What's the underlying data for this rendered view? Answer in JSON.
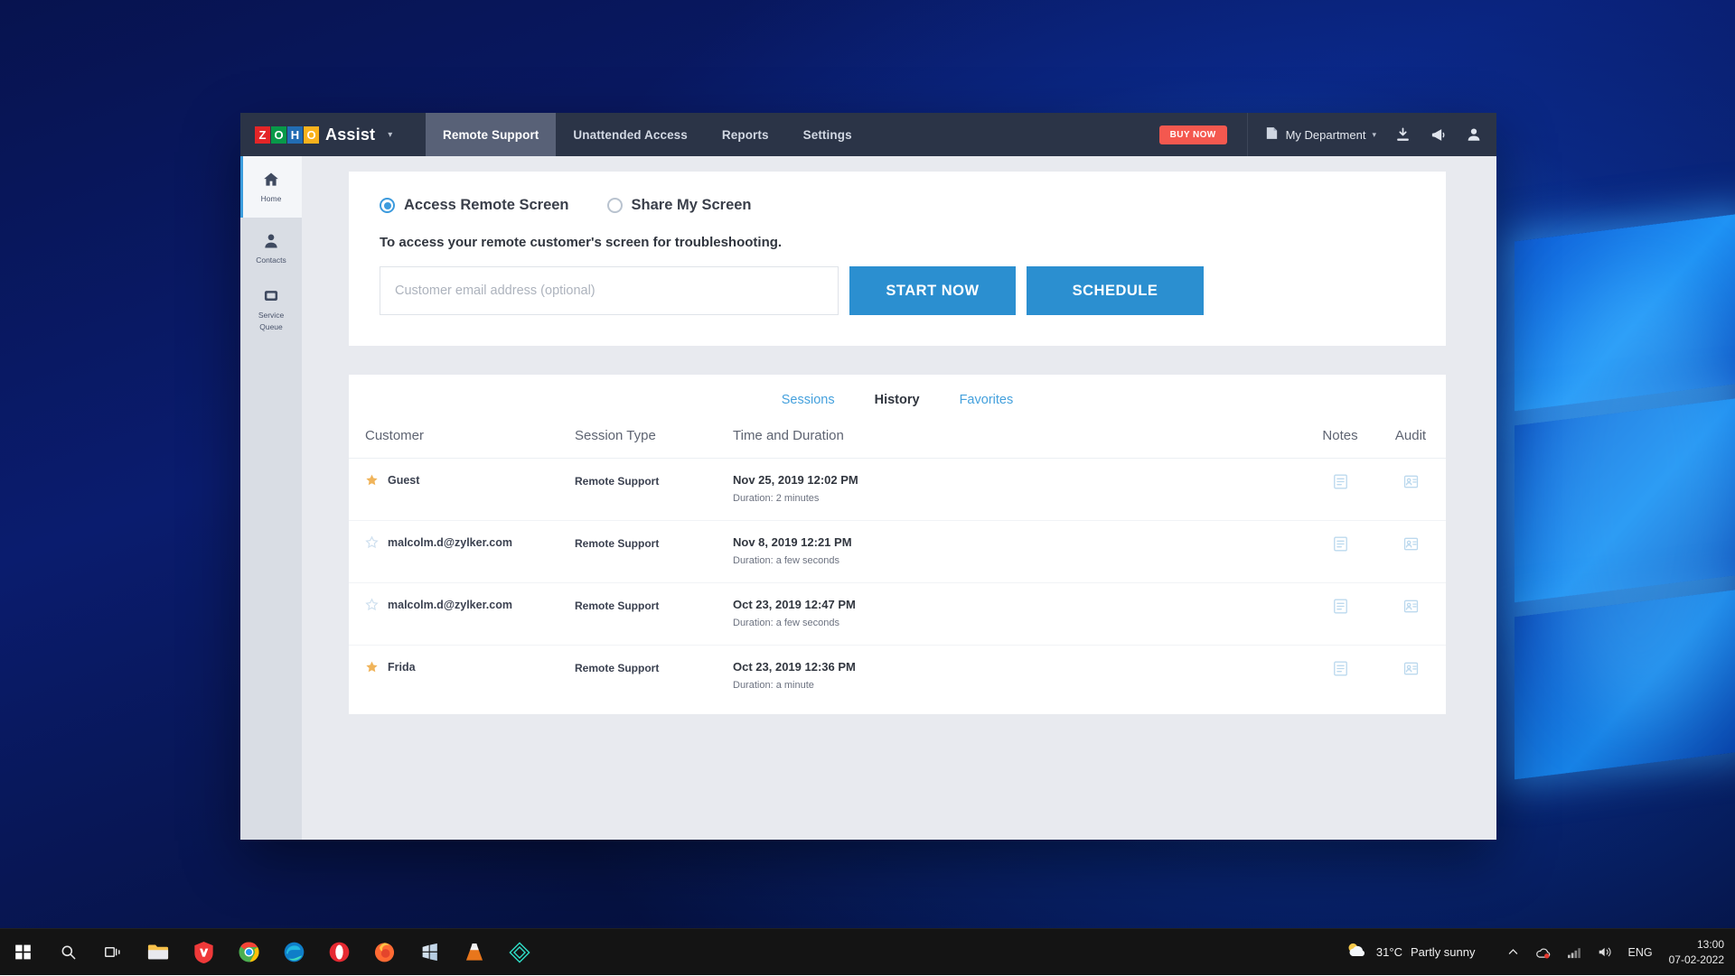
{
  "window": {
    "logo": {
      "letters": [
        {
          "char": "Z",
          "color": "#e42527"
        },
        {
          "char": "O",
          "color": "#089949"
        },
        {
          "char": "H",
          "color": "#226db4"
        },
        {
          "char": "O",
          "color": "#f9b21d"
        }
      ],
      "app_name": "Assist",
      "caret": "▾"
    },
    "nav_tabs": [
      {
        "label": "Remote Support",
        "active": true
      },
      {
        "label": "Unattended Access",
        "active": false
      },
      {
        "label": "Reports",
        "active": false
      },
      {
        "label": "Settings",
        "active": false
      }
    ],
    "buy_now_label": "BUY NOW",
    "buy_now_color": "#f4584f",
    "department": {
      "label": "My Department",
      "caret": "▾"
    },
    "top_icons": [
      "download-icon",
      "megaphone-icon",
      "user-icon"
    ]
  },
  "sidebar": {
    "items": [
      {
        "label": "Home",
        "icon": "home-icon",
        "active": true
      },
      {
        "label": "Contacts",
        "icon": "contacts-icon",
        "active": false
      },
      {
        "label": "Service\nQueue",
        "label_line1": "Service",
        "label_line2": "Queue",
        "icon": "service-queue-icon",
        "active": false
      }
    ]
  },
  "remote_panel": {
    "options": [
      {
        "label": "Access Remote Screen",
        "selected": true
      },
      {
        "label": "Share My Screen",
        "selected": false
      }
    ],
    "subtitle": "To access your remote customer's screen for troubleshooting.",
    "email_placeholder": "Customer email address (optional)",
    "email_value": "",
    "start_button": "START NOW",
    "schedule_button": "SCHEDULE",
    "accent_color": "#2b8fd0"
  },
  "history_panel": {
    "tabs": [
      {
        "label": "Sessions",
        "active": false
      },
      {
        "label": "History",
        "active": true
      },
      {
        "label": "Favorites",
        "active": false
      }
    ],
    "columns": [
      "Customer",
      "Session Type",
      "Time and Duration",
      "",
      "Notes",
      "Audit"
    ],
    "rows": [
      {
        "customer": "Guest",
        "star": "star-filled-icon",
        "star_color": "#f0b45a",
        "session_type": "Remote Support",
        "time": "Nov 25, 2019 12:02 PM",
        "duration": "Duration: 2 minutes",
        "notes_icon": "notes-icon",
        "audit_icon": "audit-icon"
      },
      {
        "customer": "malcolm.d@zylker.com",
        "star": "star-outline-icon",
        "star_color": "#cfe0ef",
        "session_type": "Remote Support",
        "time": "Nov 8, 2019 12:21 PM",
        "duration": "Duration: a few seconds",
        "notes_icon": "notes-icon",
        "audit_icon": "audit-icon"
      },
      {
        "customer": "malcolm.d@zylker.com",
        "star": "star-outline-icon",
        "star_color": "#cfe0ef",
        "session_type": "Remote Support",
        "time": "Oct 23, 2019 12:47 PM",
        "duration": "Duration: a few seconds",
        "notes_icon": "notes-icon",
        "audit_icon": "audit-icon"
      },
      {
        "customer": "Frida",
        "star": "star-filled-icon",
        "star_color": "#f0b45a",
        "session_type": "Remote Support",
        "time": "Oct 23, 2019 12:36 PM",
        "duration": "Duration: a minute",
        "notes_icon": "notes-icon",
        "audit_icon": "audit-icon"
      }
    ]
  },
  "taskbar": {
    "apps": [
      {
        "name": "start-button",
        "icon": "windows-logo-icon"
      },
      {
        "name": "search-button",
        "icon": "search-icon"
      },
      {
        "name": "task-view-button",
        "icon": "task-view-icon"
      },
      {
        "name": "file-explorer",
        "icon": "folder-icon"
      },
      {
        "name": "vivaldi-browser",
        "icon": "vivaldi-icon"
      },
      {
        "name": "chrome-browser",
        "icon": "chrome-icon"
      },
      {
        "name": "edge-browser",
        "icon": "edge-icon"
      },
      {
        "name": "opera-browser",
        "icon": "opera-icon"
      },
      {
        "name": "firefox-browser",
        "icon": "firefox-icon"
      },
      {
        "name": "microsoft-store",
        "icon": "store-icon"
      },
      {
        "name": "vlc-player",
        "icon": "vlc-cone-icon"
      },
      {
        "name": "diamond-app",
        "icon": "diamond-icon"
      }
    ],
    "weather_temp": "31°C",
    "weather_desc": "Partly sunny",
    "chevron": "∧",
    "language": "ENG",
    "time": "13:00",
    "date": "07-02-2022"
  }
}
